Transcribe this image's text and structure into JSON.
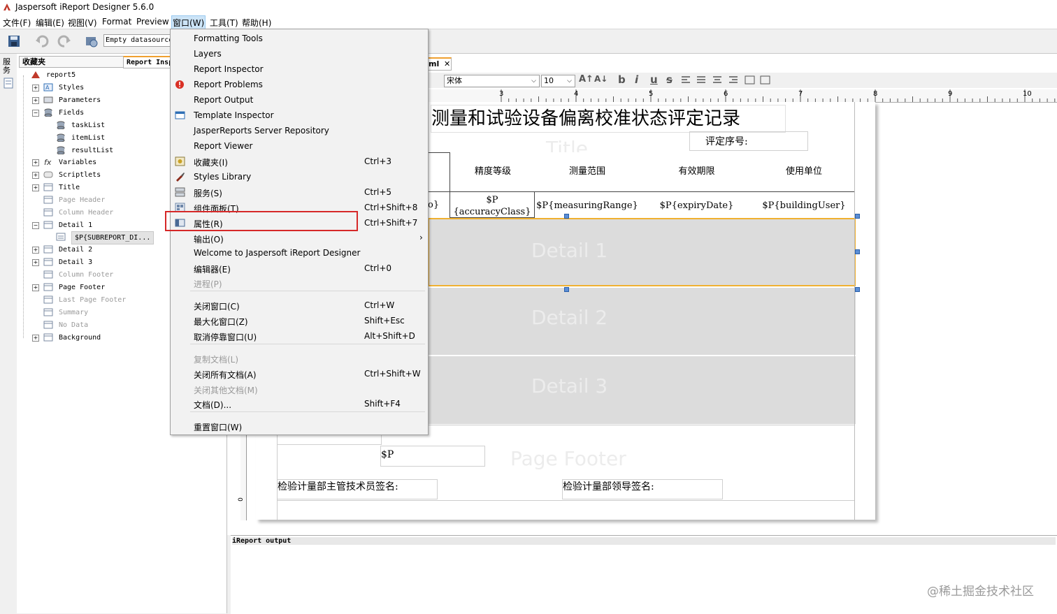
{
  "window": {
    "title": "Jaspersoft iReport Designer 5.6.0"
  },
  "menubar": [
    {
      "label": "文件(F)"
    },
    {
      "label": "编辑(E)"
    },
    {
      "label": "视图(V)"
    },
    {
      "label": "Format"
    },
    {
      "label": "Preview"
    },
    {
      "label": "窗口(W)"
    },
    {
      "label": "工具(T)"
    },
    {
      "label": "帮助(H)"
    }
  ],
  "toolbar": {
    "datasource": "Empty datasource"
  },
  "left_strip": {
    "label": "服务"
  },
  "panel": {
    "tabs": [
      {
        "label": "收藏夹"
      },
      {
        "label": "Report Inspector"
      }
    ],
    "tree": [
      {
        "label": "report5"
      },
      {
        "label": "Styles"
      },
      {
        "label": "Parameters"
      },
      {
        "label": "Fields"
      },
      {
        "label": "taskList"
      },
      {
        "label": "itemList"
      },
      {
        "label": "resultList"
      },
      {
        "label": "Variables"
      },
      {
        "label": "Scriptlets"
      },
      {
        "label": "Title"
      },
      {
        "label": "Page Header"
      },
      {
        "label": "Column Header"
      },
      {
        "label": "Detail 1"
      },
      {
        "label": "$P{SUBREPORT_DI..."
      },
      {
        "label": "Detail 2"
      },
      {
        "label": "Detail 3"
      },
      {
        "label": "Column Footer"
      },
      {
        "label": "Page Footer"
      },
      {
        "label": "Last Page Footer"
      },
      {
        "label": "Summary"
      },
      {
        "label": "No Data"
      },
      {
        "label": "Background"
      }
    ]
  },
  "editor": {
    "tab_label": "ml",
    "font_name": "宋体",
    "font_size": "10",
    "ruler": [
      "3",
      "4",
      "5",
      "6",
      "7",
      "8",
      "9",
      "10"
    ],
    "report_title": "测量和试验设备偏离校准状态评定记录",
    "serial_label": "评定序号:",
    "headers": [
      "精度等级",
      "测量范围",
      "有效期限",
      "使用单位"
    ],
    "fields": [
      "o}",
      "$P {accuracyClass}",
      "$P{measuringRange}",
      "$P{expiryDate}",
      "$P{buildingUser}"
    ],
    "band_labels": {
      "title": "Title",
      "detail1": "Detail 1",
      "detail2": "Detail 2",
      "detail3": "Detail 3",
      "page_footer": "Page Footer"
    },
    "footer_p": "$P",
    "footer_sig_left": "检验计量部主管技术员签名:",
    "footer_sig_right": "检验计量部领导签名:",
    "vruler_zero": "0"
  },
  "output": {
    "label": "iReport output"
  },
  "dropdown": {
    "items": [
      {
        "label": "Formatting Tools",
        "shortcut": "",
        "icon": "",
        "disabled": false
      },
      {
        "label": "Layers",
        "shortcut": "",
        "icon": "",
        "disabled": false
      },
      {
        "label": "Report Inspector",
        "shortcut": "",
        "icon": "",
        "disabled": false
      },
      {
        "label": "Report Problems",
        "shortcut": "",
        "icon": "error-icon",
        "disabled": false
      },
      {
        "label": "Report Output",
        "shortcut": "",
        "icon": "",
        "disabled": false
      },
      {
        "label": "Template Inspector",
        "shortcut": "",
        "icon": "template-icon",
        "disabled": false
      },
      {
        "label": "JasperReports Server Repository",
        "shortcut": "",
        "icon": "",
        "disabled": false
      },
      {
        "label": "Report Viewer",
        "shortcut": "",
        "icon": "",
        "disabled": false
      },
      {
        "label": "收藏夹(I)",
        "shortcut": "Ctrl+3",
        "icon": "favorites-icon",
        "disabled": false
      },
      {
        "label": "Styles Library",
        "shortcut": "",
        "icon": "brush-icon",
        "disabled": false
      },
      {
        "label": "服务(S)",
        "shortcut": "Ctrl+5",
        "icon": "services-icon",
        "disabled": false
      },
      {
        "label": "组件面板(T)",
        "shortcut": "Ctrl+Shift+8",
        "icon": "palette-icon",
        "disabled": false
      },
      {
        "label": "属性(R)",
        "shortcut": "Ctrl+Shift+7",
        "icon": "properties-icon",
        "disabled": false
      },
      {
        "label": "输出(O)",
        "shortcut": "",
        "icon": "",
        "disabled": false,
        "submenu": true
      },
      {
        "label": "Welcome to Jaspersoft iReport Designer",
        "shortcut": "",
        "icon": "",
        "disabled": false
      },
      {
        "label": "编辑器(E)",
        "shortcut": "Ctrl+0",
        "icon": "",
        "disabled": false
      },
      {
        "label": "进程(P)",
        "shortcut": "",
        "icon": "",
        "disabled": true
      },
      {
        "label": "关闭窗口(C)",
        "shortcut": "Ctrl+W",
        "icon": "",
        "disabled": false
      },
      {
        "label": "最大化窗口(Z)",
        "shortcut": "Shift+Esc",
        "icon": "",
        "disabled": false
      },
      {
        "label": "取消停靠窗口(U)",
        "shortcut": "Alt+Shift+D",
        "icon": "",
        "disabled": false
      },
      {
        "label": "复制文档(L)",
        "shortcut": "",
        "icon": "",
        "disabled": true
      },
      {
        "label": "关闭所有文档(A)",
        "shortcut": "Ctrl+Shift+W",
        "icon": "",
        "disabled": false
      },
      {
        "label": "关闭其他文档(M)",
        "shortcut": "",
        "icon": "",
        "disabled": true
      },
      {
        "label": "文档(D)...",
        "shortcut": "Shift+F4",
        "icon": "",
        "disabled": false
      },
      {
        "label": "重置窗口(W)",
        "shortcut": "",
        "icon": "",
        "disabled": false
      }
    ]
  },
  "watermark": "@稀土掘金技术社区",
  "colors": {
    "highlight": "#d62828",
    "band": "#dcdcdc",
    "selection": "#f0b030"
  }
}
